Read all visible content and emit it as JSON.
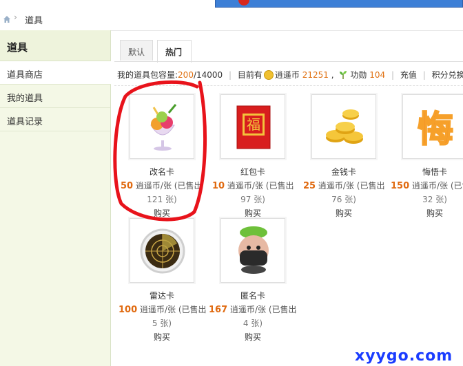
{
  "breadcrumb": {
    "current": "道具"
  },
  "sidebar": {
    "title": "道具",
    "items": [
      {
        "label": "道具商店",
        "active": true
      },
      {
        "label": "我的道具",
        "active": false
      },
      {
        "label": "道具记录",
        "active": false
      }
    ]
  },
  "tabs": [
    {
      "label": "默认",
      "active": false
    },
    {
      "label": "热门",
      "active": true
    }
  ],
  "info": {
    "capacity_label": "我的道具包容量:",
    "capacity_used": "200",
    "capacity_total": "/14000",
    "current_label": "目前有",
    "currency_name": "逍遥币",
    "currency_amount": "21251",
    "comma": ",",
    "merit_label": "功勋",
    "merit_amount": "104",
    "recharge": "充值",
    "exchange": "积分兑换"
  },
  "items": [
    {
      "name": "改名卡",
      "price": "50",
      "unit": "逍遥币/张",
      "sold_prefix": "(已售出",
      "sold_line": "121 张)",
      "buy": "购买",
      "icon": "ice-cream-sundae-icon"
    },
    {
      "name": "红包卡",
      "price": "10",
      "unit": "逍遥币/张",
      "sold_prefix": "(已售出",
      "sold_line": "97 张)",
      "buy": "购买",
      "icon": "red-envelope-icon",
      "icon_text": "福"
    },
    {
      "name": "金钱卡",
      "price": "25",
      "unit": "逍遥币/张",
      "sold_prefix": "(已售出",
      "sold_line": "76 张)",
      "buy": "购买",
      "icon": "gold-coins-icon"
    },
    {
      "name": "悔悟卡",
      "price": "150",
      "unit": "逍遥币/张",
      "sold_prefix": "(已售",
      "sold_line": "32 张)",
      "buy": "购买",
      "icon": "regret-card-icon",
      "icon_text": "悔"
    },
    {
      "name": "雷达卡",
      "price": "100",
      "unit": "逍遥币/张",
      "sold_prefix": "(已售出",
      "sold_line": "5 张)",
      "buy": "购买",
      "icon": "radar-icon"
    },
    {
      "name": "匿名卡",
      "price": "167",
      "unit": "逍遥币/张",
      "sold_prefix": "(已售出",
      "sold_line": "4 张)",
      "buy": "购买",
      "icon": "masked-ninja-icon"
    }
  ],
  "watermark": "xyygo.com",
  "colors": {
    "accent_orange": "#e06a10",
    "sidebar_bg": "#f4f8e6",
    "annotation_red": "#e8131b",
    "watermark_blue": "#1a3cff"
  }
}
